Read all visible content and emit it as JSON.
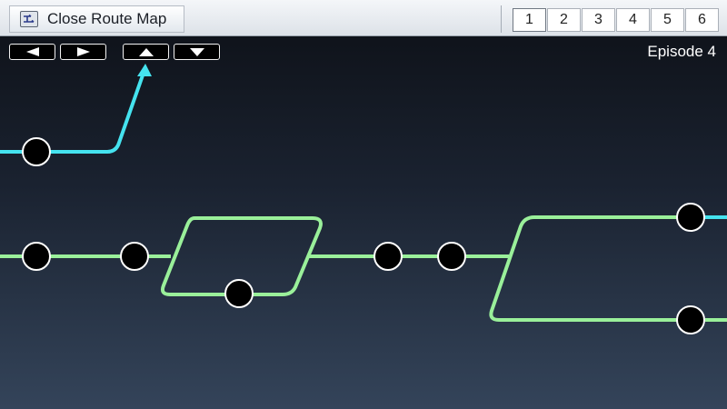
{
  "toolbar": {
    "close_label": "Close Route Map",
    "close_icon": "route-map-icon"
  },
  "episode_tabs": [
    {
      "label": "1",
      "active": true
    },
    {
      "label": "2",
      "active": false
    },
    {
      "label": "3",
      "active": false
    },
    {
      "label": "4",
      "active": false
    },
    {
      "label": "5",
      "active": false
    },
    {
      "label": "6",
      "active": false
    }
  ],
  "nav": {
    "left_icon": "arrow-left-icon",
    "right_icon": "arrow-right-icon",
    "up_icon": "arrow-up-icon",
    "down_icon": "arrow-down-icon"
  },
  "episode_label": "Episode 4",
  "colors": {
    "cyan_route": "#45e3ef",
    "green_route": "#9af09a",
    "node_fill": "#000000",
    "node_stroke": "#ffffff"
  },
  "route_map": {
    "cyan_nodes": 1,
    "green_nodes": 8,
    "edge_nodes_right": 2
  }
}
